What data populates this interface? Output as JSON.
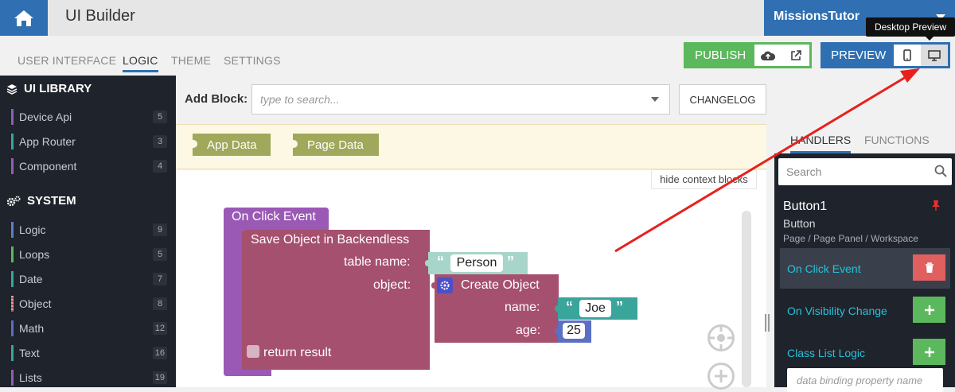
{
  "header": {
    "app_title": "UI Builder",
    "user_name": "MissionsTutor",
    "home_icon": "home-icon"
  },
  "nav_tabs": [
    {
      "label": "USER INTERFACE",
      "active": false
    },
    {
      "label": "LOGIC",
      "active": true
    },
    {
      "label": "THEME",
      "active": false
    },
    {
      "label": "SETTINGS",
      "active": false
    }
  ],
  "publish": {
    "label": "PUBLISH",
    "icons": [
      "cloud-upload-icon",
      "external-link-icon"
    ]
  },
  "preview": {
    "label": "PREVIEW",
    "icons": [
      "mobile-icon",
      "desktop-icon"
    ],
    "tooltip": "Desktop Preview"
  },
  "sidebar": {
    "ui_library_title": "UI LIBRARY",
    "ui_library_items": [
      {
        "label": "Device Api",
        "count": "5",
        "color": "#8e5fb5"
      },
      {
        "label": "App Router",
        "count": "3",
        "color": "#3aa59a"
      },
      {
        "label": "Component",
        "count": "4",
        "color": "#8e5fb5"
      }
    ],
    "system_title": "SYSTEM",
    "system_items": [
      {
        "label": "Logic",
        "count": "9",
        "color": "#5b7fc4"
      },
      {
        "label": "Loops",
        "count": "5",
        "color": "#5cb85c"
      },
      {
        "label": "Date",
        "count": "7",
        "color": "#3aa59a"
      },
      {
        "label": "Object",
        "count": "8",
        "color": "#b05a5a"
      },
      {
        "label": "Math",
        "count": "12",
        "color": "#5b6fc4"
      },
      {
        "label": "Text",
        "count": "16",
        "color": "#3aa59a"
      },
      {
        "label": "Lists",
        "count": "19",
        "color": "#8e5fb5"
      }
    ]
  },
  "add_block": {
    "label": "Add Block:",
    "placeholder": "type to search...",
    "changelog_label": "CHANGELOG"
  },
  "context_blocks": {
    "items": [
      "App Data",
      "Page Data"
    ],
    "hide_label": "hide context blocks"
  },
  "logic_blocks": {
    "event_title": "On Click Event",
    "save_title": "Save Object in Backendless",
    "table_name_label": "table name:",
    "table_name_value": "Person",
    "object_label": "object:",
    "create_title": "Create Object",
    "name_label": "name:",
    "name_value": "Joe",
    "age_label": "age:",
    "age_value": "25",
    "return_result_label": "return result",
    "quote_open": "“",
    "quote_close": "”"
  },
  "right_panel": {
    "tabs": [
      {
        "label": "HANDLERS",
        "active": true
      },
      {
        "label": "FUNCTIONS",
        "active": false
      }
    ],
    "search_placeholder": "Search",
    "component_name": "Button1",
    "component_type": "Button",
    "component_path": "Page / Page Panel / Workspace",
    "handlers": [
      {
        "label": "On Click Event",
        "action": "delete",
        "selected": true
      },
      {
        "label": "On Visibility Change",
        "action": "add",
        "selected": false
      },
      {
        "label": "Class List Logic",
        "action": "add",
        "selected": false
      }
    ],
    "binding_placeholder": "data binding property name"
  },
  "colors": {
    "brand_blue": "#2f6fb2",
    "publish_green": "#5cb85c",
    "event_purple": "#9b59b6",
    "backendless_pink": "#a5506e",
    "text_block": "#a8d5c9",
    "context_block": "#a0a85b",
    "annotation_red": "#e8201c"
  }
}
